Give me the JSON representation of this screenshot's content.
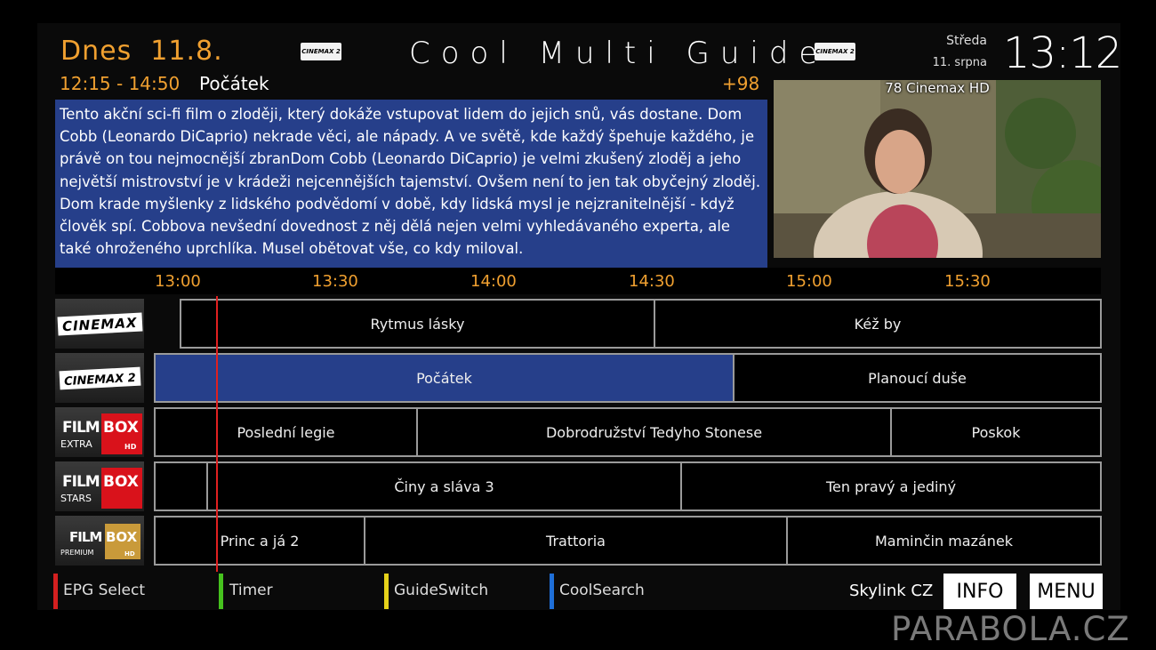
{
  "header": {
    "day_label": "Dnes",
    "date": "11.8.",
    "guide_title": "Cool Multi Guide",
    "channel_logo_text": "CINEMAX 2",
    "weekday": "Středa",
    "date_long": "11. srpna",
    "clock": "13:12"
  },
  "program": {
    "time_range": "12:15 - 14:50",
    "title": "Počátek",
    "channel_number_badge": "+98",
    "description": "Tento akční sci-fi film o zloději, který dokáže vstupovat lidem do jejich snů, vás dostane. Dom Cobb (Leonardo DiCaprio) nekrade věci, ale nápady. A ve světě, kde každý špehuje každého, je právě on tou nejmocnější zbranDom Cobb (Leonardo DiCaprio) je velmi zkušený zloděj a jeho největší mistrovství je v krádeži nejcennějších tajemství. Ovšem není to jen tak obyčejný zloděj. Dom krade myšlenky z lidského podvědomí v době, kdy lidská mysl je nejzranitelnější - když člověk spí. Cobbova nevšední dovednost z něj dělá nejen velmi vyhledávaného experta, ale také ohroženého uprchlíka. Musel obětovat vše, co kdy miloval."
  },
  "preview": {
    "label": "78  Cinemax HD"
  },
  "timeline": {
    "ticks": [
      "13:00",
      "13:30",
      "14:00",
      "14:30",
      "15:00",
      "15:30"
    ]
  },
  "channels": [
    {
      "logo": "CINEMAX",
      "programs": [
        "Rytmus lásky",
        "Kéž by"
      ]
    },
    {
      "logo": "CINEMAX 2",
      "programs": [
        "Počátek",
        "Planoucí duše"
      ]
    },
    {
      "logo_a": "FILM",
      "logo_b": "BOX",
      "logo_c": "EXTRA",
      "logo_d": "HD",
      "programs": [
        "Poslední legie",
        "Dobrodružství Tedyho Stonese",
        "Poskok"
      ]
    },
    {
      "logo_a": "FILM",
      "logo_b": "BOX",
      "logo_c": "STARS",
      "programs": [
        "Činy a sláva 3",
        "Ten pravý a jediný"
      ]
    },
    {
      "logo_a": "FILM",
      "logo_b": "BOX",
      "logo_c": "PREMIUM",
      "logo_d": "HD",
      "programs": [
        "Princ a já 2",
        "Trattoria",
        "Maminčin mazánek"
      ]
    }
  ],
  "footer": {
    "red": "EPG Select",
    "green": "Timer",
    "yellow": "GuideSwitch",
    "blue": "CoolSearch",
    "provider": "Skylink CZ",
    "info_button": "INFO",
    "menu_button": "MENU",
    "colors": {
      "red": "#d42020",
      "green": "#46c21e",
      "yellow": "#e6d21a",
      "blue": "#1f6fd8"
    }
  },
  "watermark": "PARABOLA.CZ"
}
